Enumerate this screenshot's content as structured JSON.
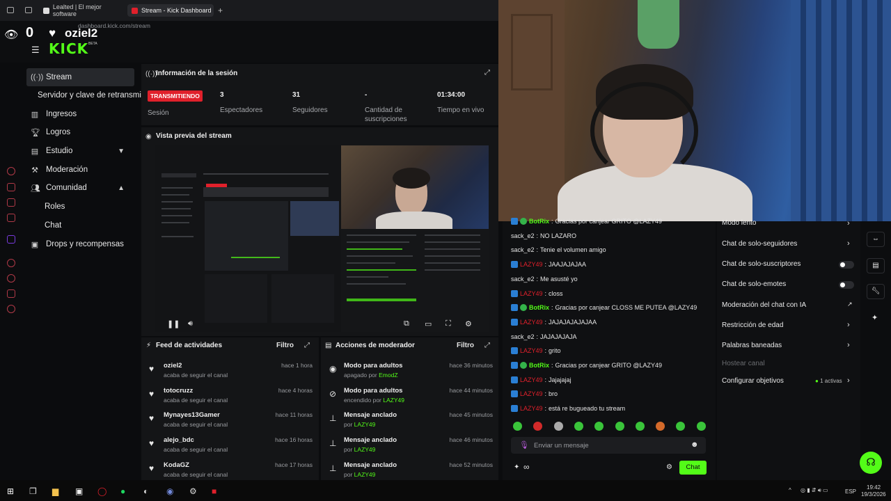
{
  "browser": {
    "tabs": [
      {
        "label": "Lealted | El mejor software"
      },
      {
        "label": "Stream - Kick Dashboard"
      }
    ],
    "new_tab": "+",
    "url": "dashboard.kick.com/stream"
  },
  "overlay": {
    "viewer_count": "0",
    "username": "oziel2"
  },
  "brand": {
    "logo": "KICK",
    "beta": "BETA"
  },
  "sidebar": {
    "items": [
      {
        "label": "Stream"
      },
      {
        "label": "Servidor y clave de retransmi"
      },
      {
        "label": "Ingresos"
      },
      {
        "label": "Logros"
      },
      {
        "label": "Estudio"
      },
      {
        "label": "Moderación"
      },
      {
        "label": "Comunidad"
      },
      {
        "label": "Roles"
      },
      {
        "label": "Chat"
      },
      {
        "label": "Drops y recompensas"
      }
    ]
  },
  "session": {
    "title": "Información de la sesión",
    "live_badge": "TRANSMITIENDO",
    "live_label": "Sesión",
    "stats": [
      {
        "value": "3",
        "label": "Espectadores"
      },
      {
        "value": "31",
        "label": "Seguidores"
      },
      {
        "value": "-",
        "label": "Cantidad de suscripciones"
      },
      {
        "value": "01:34:00",
        "label": "Tiempo en vivo"
      }
    ]
  },
  "preview": {
    "title": "Vista previa del stream"
  },
  "feed": {
    "title": "Feed de actividades",
    "filter": "Filtro",
    "items": [
      {
        "name": "oziel2",
        "sub": "acaba de seguir el canal",
        "time": "hace 1 hora"
      },
      {
        "name": "totocruzz",
        "sub": "acaba de seguir el canal",
        "time": "hace 4 horas"
      },
      {
        "name": "Mynayes13Gamer",
        "sub": "acaba de seguir el canal",
        "time": "hace 11 horas"
      },
      {
        "name": "alejo_bdc",
        "sub": "acaba de seguir el canal",
        "time": "hace 16 horas"
      },
      {
        "name": "KodaGZ",
        "sub": "acaba de seguir el canal",
        "time": "hace 17 horas"
      }
    ]
  },
  "modactions": {
    "title": "Acciones de moderador",
    "filter": "Filtro",
    "items": [
      {
        "name": "Modo para adultos",
        "sub": "apagado por",
        "who": "EmodZ",
        "time": "hace 36 minutos"
      },
      {
        "name": "Modo para adultos",
        "sub": "encendido por",
        "who": "LAZY49",
        "time": "hace 44 minutos"
      },
      {
        "name": "Mensaje anclado",
        "sub": "por",
        "who": "LAZY49",
        "time": "hace 45 minutos"
      },
      {
        "name": "Mensaje anclado",
        "sub": "por",
        "who": "LAZY49",
        "time": "hace 46 minutos"
      },
      {
        "name": "Mensaje anclado",
        "sub": "por",
        "who": "LAZY49",
        "time": "hace 52 minutos"
      }
    ]
  },
  "chat": {
    "messages": [
      {
        "user": "BotRix",
        "text": "Gracias por canjear GRITO @LAZY49",
        "kind": "bot"
      },
      {
        "user": "sack_e2",
        "text": "NO LAZARO",
        "kind": "plain"
      },
      {
        "user": "sack_e2",
        "text": "Tenie el volumen amigo",
        "kind": "plain"
      },
      {
        "user": "LAZY49",
        "text": "JAAJAJAJAA",
        "kind": "mod"
      },
      {
        "user": "sack_e2",
        "text": "Me asusté yo",
        "kind": "plain"
      },
      {
        "user": "LAZY49",
        "text": "closs",
        "kind": "mod"
      },
      {
        "user": "BotRix",
        "text": "Gracias por canjear CLOSS ME PUTEA @LAZY49",
        "kind": "bot"
      },
      {
        "user": "LAZY49",
        "text": "JAJAJAJAJAJAA",
        "kind": "mod"
      },
      {
        "user": "sack_e2",
        "text": "JAJAJAJAJA",
        "kind": "plain"
      },
      {
        "user": "LAZY49",
        "text": "grito",
        "kind": "mod"
      },
      {
        "user": "BotRix",
        "text": "Gracias por canjear GRITO @LAZY49",
        "kind": "bot"
      },
      {
        "user": "LAZY49",
        "text": "Jajajajaj",
        "kind": "mod"
      },
      {
        "user": "LAZY49",
        "text": "bro",
        "kind": "mod"
      },
      {
        "user": "LAZY49",
        "text": "está re bugueado tu stream",
        "kind": "mod"
      }
    ],
    "placeholder": "Enviar un mensaje",
    "send": "Chat",
    "infinity": "∞"
  },
  "settings": {
    "rows": [
      {
        "label": "Modo lento"
      },
      {
        "label": "Chat de solo-seguidores"
      },
      {
        "label": "Chat de solo-suscriptores"
      },
      {
        "label": "Chat de solo-emotes"
      },
      {
        "label": "Moderación del chat con IA"
      },
      {
        "label": "Restricción de edad"
      },
      {
        "label": "Palabras baneadas"
      },
      {
        "label": "Hostear canal"
      },
      {
        "label": "Configurar objetivos"
      }
    ],
    "goals_active": "1 activas"
  },
  "taskbar": {
    "lang": "ESP",
    "time": "19:42",
    "date": "19/3/2026"
  },
  "colors": {
    "accent": "#53fc18",
    "live": "#e0202b",
    "panel": "#141517"
  }
}
